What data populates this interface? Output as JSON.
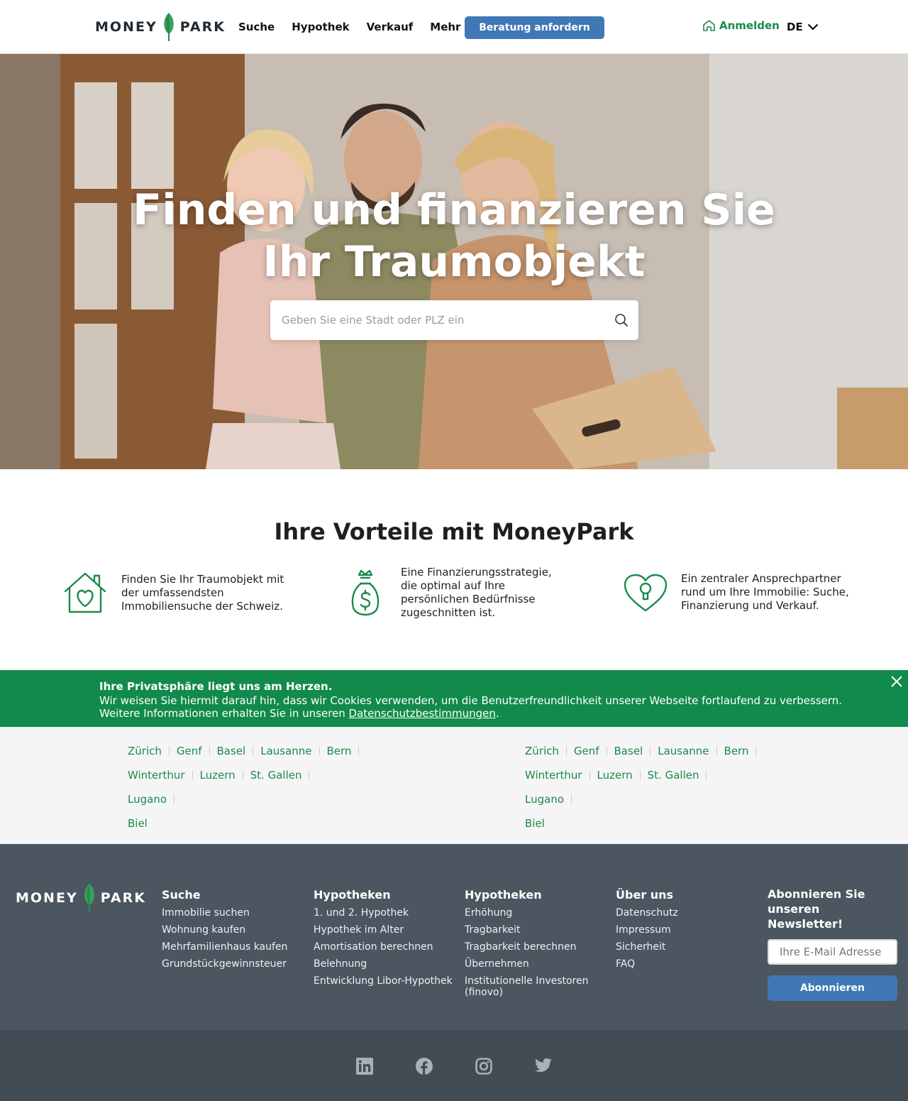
{
  "header": {
    "logo_left": "MONEY",
    "logo_right": "PARK",
    "nav": [
      "Suche",
      "Hypothek",
      "Verkauf",
      "Mehr"
    ],
    "cta_label": "Beratung anfordern",
    "login_label": "Anmelden",
    "language": "DE"
  },
  "hero": {
    "title_line1": "Finden und finanzieren Sie",
    "title_line2": "Ihr Traumobjekt",
    "search_placeholder": "Geben Sie eine Stadt oder PLZ ein"
  },
  "benefits": {
    "title": "Ihre Vorteile mit MoneyPark",
    "items": [
      {
        "icon": "house-heart-icon",
        "text": "Finden Sie Ihr Traumobjekt mit der umfassendsten Immobiliensuche der Schweiz."
      },
      {
        "icon": "money-bag-icon",
        "text": "Eine Finanzierungsstrategie, die optimal auf Ihre persönlichen Bedürfnisse zugeschnitten ist."
      },
      {
        "icon": "heart-keyhole-icon",
        "text": "Ein zentraler Ansprechpartner rund um Ihre Immobilie: Suche, Finanzierung und Verkauf."
      }
    ]
  },
  "cookie": {
    "title": "Ihre Privatsphäre liegt uns am Herzen.",
    "line1": "Wir weisen Sie hiermit darauf hin, dass wir Cookies verwenden, um die Benutzerfreundlichkeit unserer Webseite fortlaufend zu verbessern.",
    "line2_prefix": "Weitere Informationen erhalten Sie in unseren ",
    "link": "Datenschutzbestimmungen",
    "line2_suffix": "."
  },
  "cities": {
    "left": [
      "Zürich",
      "Genf",
      "Basel",
      "Lausanne",
      "Bern",
      "Winterthur",
      "Luzern",
      "St. Gallen",
      "Lugano",
      "Biel"
    ],
    "right": [
      "Zürich",
      "Genf",
      "Basel",
      "Lausanne",
      "Bern",
      "Winterthur",
      "Luzern",
      "St. Gallen",
      "Lugano",
      "Biel"
    ]
  },
  "footer": {
    "columns": [
      {
        "head": "Suche",
        "links": [
          "Immobilie suchen",
          "Wohnung kaufen",
          "Mehrfamilienhaus kaufen",
          "Grundstückgewinnsteuer"
        ]
      },
      {
        "head": "Hypotheken",
        "links": [
          "1. und 2. Hypothek",
          "Hypothek im Alter",
          "Amortisation berechnen",
          "Belehnung",
          "Entwicklung Libor-Hypothek"
        ]
      },
      {
        "head": "Hypotheken",
        "links": [
          "Erhöhung",
          "Tragbarkeit",
          "Tragbarkeit berechnen",
          "Übernehmen",
          "Institutionelle Investoren (finovo)"
        ]
      },
      {
        "head": "Über uns",
        "links": [
          "Datenschutz",
          "Impressum",
          "Sicherheit",
          "FAQ"
        ]
      }
    ],
    "newsletter_head": "Abonnieren Sie unseren Newsletter!",
    "newsletter_placeholder": "Ihre E-Mail Adresse",
    "newsletter_button": "Abonnieren",
    "social": [
      "linkedin-icon",
      "facebook-icon",
      "instagram-icon",
      "twitter-icon"
    ]
  },
  "colors": {
    "brand_green": "#1c8a4b",
    "cookie_green": "#128a4b",
    "cta_blue": "#3f78b5",
    "footer_bg": "#4b5660",
    "footer_bottom_bg": "#414c55"
  }
}
